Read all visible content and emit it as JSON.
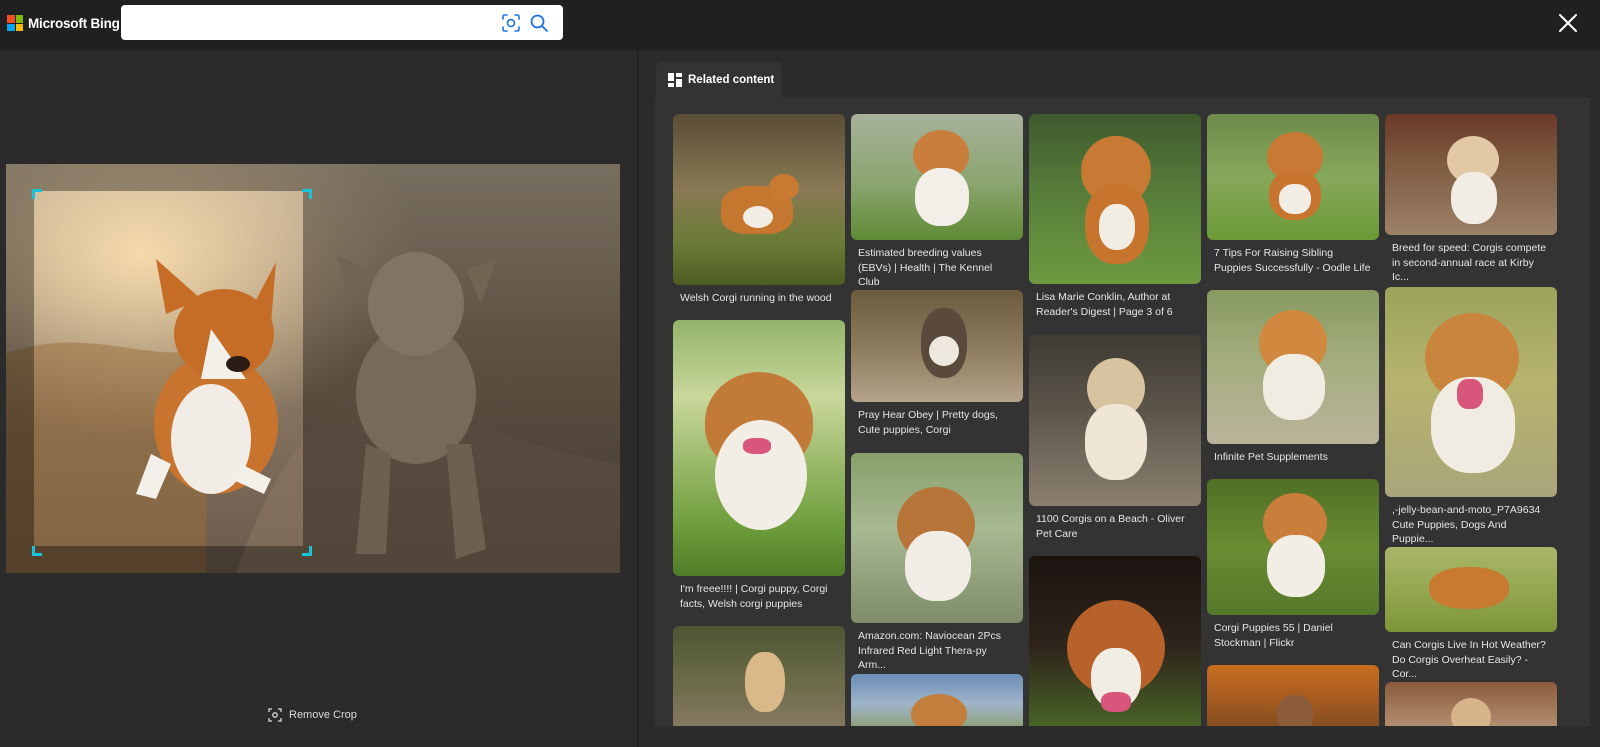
{
  "header": {
    "brand": "Microsoft Bing",
    "search_placeholder": "",
    "search_value": ""
  },
  "icons": {
    "logo": "microsoft-logo-icon",
    "visual_search": "visual-search-icon",
    "search": "search-icon",
    "close": "close-icon",
    "remove_crop": "crop-icon",
    "related": "related-grid-icon"
  },
  "colors": {
    "accent_crop": "#19c3d9",
    "search_icon_blue": "#1a73e8",
    "ms_red": "#f25022",
    "ms_green": "#7fba00",
    "ms_blue": "#00a4ef",
    "ms_yellow": "#ffb900"
  },
  "left": {
    "remove_crop_label": "Remove Crop"
  },
  "right": {
    "tab_label": "Related content",
    "results": [
      {
        "caption": "Welsh Corgi running in the wood"
      },
      {
        "caption": "I'm freee!!!! | Corgi puppy, Corgi facts, Welsh corgi puppies"
      },
      {
        "caption": ""
      },
      {
        "caption": "Estimated breeding values (EBVs) | Health | The Kennel Club"
      },
      {
        "caption": "Pray Hear Obey | Pretty dogs, Cute puppies, Corgi"
      },
      {
        "caption": "Amazon.com: Naviocean 2Pcs Infrared Red Light Thera-py Arm..."
      },
      {
        "caption": ""
      },
      {
        "caption": "Lisa Marie Conklin, Author at Reader's Digest | Page 3 of 6"
      },
      {
        "caption": "1100 Corgis on a Beach - Oliver Pet Care"
      },
      {
        "caption": ""
      },
      {
        "caption": "7 Tips For Raising Sibling Puppies Successfully - Oodle Life"
      },
      {
        "caption": "Infinite Pet Supplements"
      },
      {
        "caption": "Corgi Puppies 55 | Daniel Stockman | Flickr"
      },
      {
        "caption": ""
      },
      {
        "caption": "Breed for speed: Corgis compete in second-annual race at Kirby Ic..."
      },
      {
        "caption": ",-jelly-bean-and-moto_P7A9634 Cute Puppies, Dogs And Puppie..."
      },
      {
        "caption": "Can Corgis Live In Hot Weather? Do Corgis Overheat Easily? - Cor..."
      },
      {
        "caption": ""
      }
    ]
  }
}
